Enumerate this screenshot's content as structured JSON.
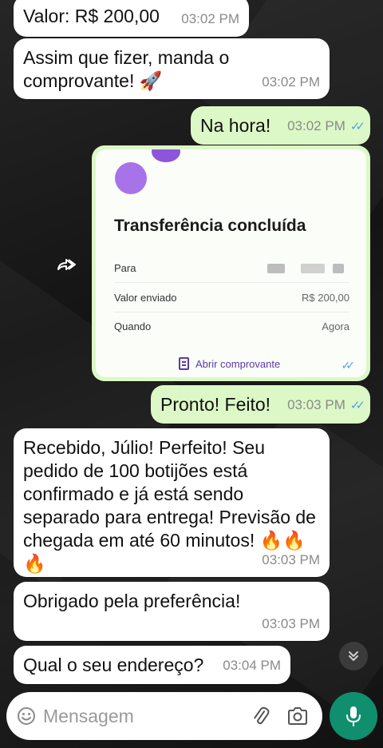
{
  "chat": {
    "messages": [
      {
        "direction": "in",
        "text": "Valor: R$ 200,00",
        "time": "03:02 PM"
      },
      {
        "direction": "in",
        "text": "Assim que fizer, manda o comprovante! 🚀",
        "time": "03:02 PM"
      },
      {
        "direction": "out",
        "text": "Na hora!",
        "time": "03:02 PM",
        "status": "read"
      },
      {
        "direction": "out",
        "type": "receipt",
        "status": "read"
      },
      {
        "direction": "out",
        "text": "Pronto! Feito!",
        "time": "03:03 PM",
        "status": "read"
      },
      {
        "direction": "in",
        "text": "Recebido, Júlio! Perfeito! Seu pedido de 100 botijões está confirmado e já está sendo separado para entrega! Previsão de chegada em até 60 minutos! 🔥🔥🔥",
        "time": "03:03 PM"
      },
      {
        "direction": "in",
        "text": "Obrigado pela preferência!",
        "time": "03:03 PM"
      },
      {
        "direction": "in",
        "text": "Qual o seu endereço?",
        "time": "03:04 PM"
      }
    ]
  },
  "receipt": {
    "title": "Transferência concluída",
    "rows": [
      {
        "label": "Para",
        "value": ""
      },
      {
        "label": "Valor enviado",
        "value": "R$ 200,00"
      },
      {
        "label": "Quando",
        "value": "Agora"
      }
    ],
    "link_label": "Abrir comprovante"
  },
  "composer": {
    "placeholder": "Mensagem"
  },
  "icons": {
    "forward": "forward-icon",
    "emoji": "emoji-icon",
    "attach": "paperclip-icon",
    "camera": "camera-icon",
    "mic": "microphone-icon",
    "scroll": "chevron-double-down-icon"
  },
  "colors": {
    "incoming_bubble": "#ffffff",
    "outgoing_bubble": "#dcf8c6",
    "read_ticks": "#4fa3e8",
    "mic_button": "#0f8f6e",
    "receipt_accent": "#a872e8"
  }
}
